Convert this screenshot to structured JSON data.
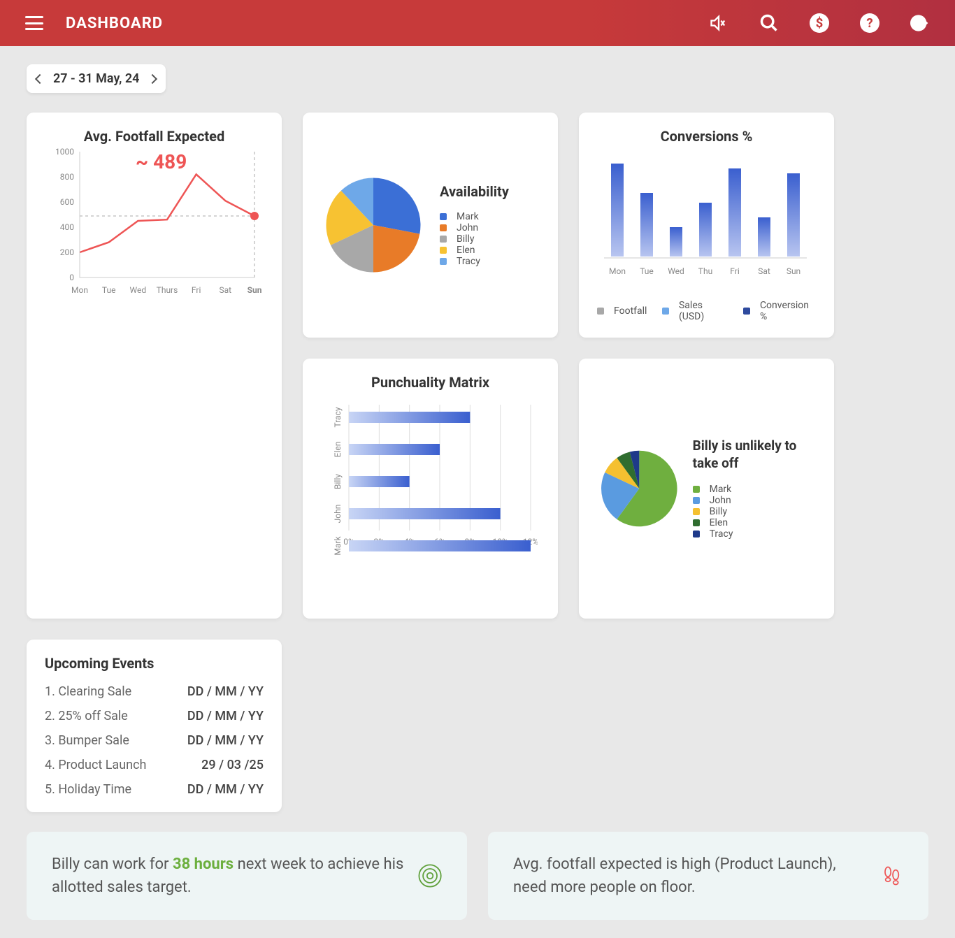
{
  "header": {
    "title": "DASHBOARD"
  },
  "date_range": "27 - 31 May, 24",
  "availability": {
    "title": "Availability",
    "legend": [
      "Mark",
      "John",
      "Billy",
      "Elen",
      "Tracy"
    ]
  },
  "punctuality": {
    "title": "Punchuality Matrix"
  },
  "conversions": {
    "title": "Conversions %",
    "legend": [
      "Footfall",
      "Sales (USD)",
      "Conversion %"
    ]
  },
  "footfall": {
    "title": "Avg. Footfall Expected",
    "value": "~ 489"
  },
  "takeoff": {
    "title": "Billy is unlikely to take off",
    "legend": [
      "Mark",
      "John",
      "Billy",
      "Elen",
      "Tracy"
    ]
  },
  "upcoming": {
    "title": "Upcoming Events",
    "events": [
      {
        "n": "1.",
        "name": "Clearing Sale",
        "date": "DD / MM / YY"
      },
      {
        "n": "2.",
        "name": "25% off Sale",
        "date": "DD / MM / YY"
      },
      {
        "n": "3.",
        "name": "Bumper Sale",
        "date": "DD / MM / YY"
      },
      {
        "n": "4.",
        "name": "Product Launch",
        "date": "29 / 03 /25"
      },
      {
        "n": "5.",
        "name": "Holiday Time",
        "date": "DD / MM / YY"
      }
    ]
  },
  "insight1": {
    "pre": "Billy can work for ",
    "highlight": "38 hours",
    "post": " next week to achieve his allotted sales target."
  },
  "insight2": {
    "text": "Avg. footfall expected is high (Product Launch), need more people on floor."
  },
  "chart_data": [
    {
      "type": "pie",
      "title": "Availability",
      "series": [
        {
          "name": "Availability",
          "slices": [
            {
              "label": "Mark",
              "value": 28,
              "color": "#3B6FD6"
            },
            {
              "label": "John",
              "value": 22,
              "color": "#E87B28"
            },
            {
              "label": "Billy",
              "value": 18,
              "color": "#A8A8A8"
            },
            {
              "label": "Elen",
              "value": 20,
              "color": "#F7C232"
            },
            {
              "label": "Tracy",
              "value": 12,
              "color": "#6EA8E8"
            }
          ]
        }
      ]
    },
    {
      "type": "bar",
      "title": "Punchuality Matrix",
      "orientation": "horizontal",
      "categories": [
        "Tracy",
        "Elen",
        "Billy",
        "John",
        "Mark"
      ],
      "values": [
        8,
        6,
        4,
        10,
        12
      ],
      "xlabel": "",
      "xlim": [
        0,
        12
      ],
      "x_ticks": [
        "0%",
        "2%",
        "4%",
        "6%",
        "8%",
        "10%",
        "12%"
      ]
    },
    {
      "type": "bar",
      "title": "Conversions %",
      "categories": [
        "Mon",
        "Tue",
        "Wed",
        "Thu",
        "Fri",
        "Sat",
        "Sun"
      ],
      "values": [
        95,
        65,
        30,
        55,
        90,
        40,
        85
      ],
      "ylim": [
        0,
        100
      ],
      "legend": [
        "Footfall",
        "Sales (USD)",
        "Conversion %"
      ]
    },
    {
      "type": "line",
      "title": "Avg. Footfall Expected",
      "categories": [
        "Mon",
        "Tue",
        "Wed",
        "Thurs",
        "Fri",
        "Sat",
        "Sun"
      ],
      "values": [
        200,
        280,
        450,
        460,
        820,
        610,
        489
      ],
      "ylim": [
        0,
        1000
      ],
      "y_ticks": [
        0,
        200,
        400,
        600,
        800,
        1000
      ],
      "annotations": [
        {
          "text": "~ 489"
        }
      ]
    },
    {
      "type": "pie",
      "title": "Billy is unlikely to take off",
      "series": [
        {
          "name": "Take-off likelihood",
          "slices": [
            {
              "label": "Mark",
              "value": 60,
              "color": "#6FAF3F"
            },
            {
              "label": "John",
              "value": 22,
              "color": "#5A9BE0"
            },
            {
              "label": "Billy",
              "value": 8,
              "color": "#F5C030"
            },
            {
              "label": "Elen",
              "value": 6,
              "color": "#2F6D2F"
            },
            {
              "label": "Tracy",
              "value": 4,
              "color": "#1E3A8A"
            }
          ]
        }
      ]
    }
  ]
}
